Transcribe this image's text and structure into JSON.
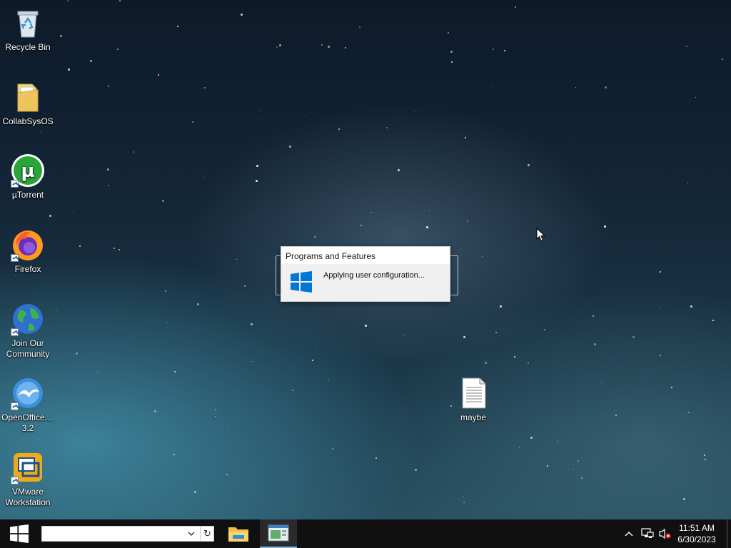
{
  "desktop": {
    "icons": [
      {
        "label": "Recycle Bin",
        "icon": "recycle-bin-icon",
        "shortcut": false
      },
      {
        "label": "CollabSysOS",
        "icon": "folder-icon",
        "shortcut": false
      },
      {
        "label": "µTorrent",
        "icon": "utorrent-icon",
        "shortcut": true
      },
      {
        "label": "Firefox",
        "icon": "firefox-icon",
        "shortcut": true
      },
      {
        "label": "Join Our Community",
        "icon": "globe-icon",
        "shortcut": true
      },
      {
        "label": "OpenOffice.... 3.2",
        "icon": "openoffice-icon",
        "shortcut": true
      },
      {
        "label": "VMware Workstation",
        "icon": "vmware-icon",
        "shortcut": true
      },
      {
        "label": "maybe",
        "icon": "text-file-icon",
        "shortcut": false
      }
    ]
  },
  "dialog": {
    "title": "Programs and Features",
    "message": "Applying user configuration...",
    "icon": "windows-logo-icon"
  },
  "taskbar": {
    "search": {
      "value": "",
      "placeholder": ""
    },
    "apps": [
      {
        "icon": "file-explorer-icon",
        "active": false
      },
      {
        "icon": "programs-window-icon",
        "active": true
      }
    ],
    "tray": [
      "chevron-up-icon",
      "network-icon",
      "volume-muted-icon"
    ],
    "clock": {
      "time": "11:51 AM",
      "date": "6/30/2023"
    }
  },
  "colors": {
    "accent": "#0078d7",
    "taskbar": "#101010",
    "active_indicator": "#76b9ed"
  }
}
